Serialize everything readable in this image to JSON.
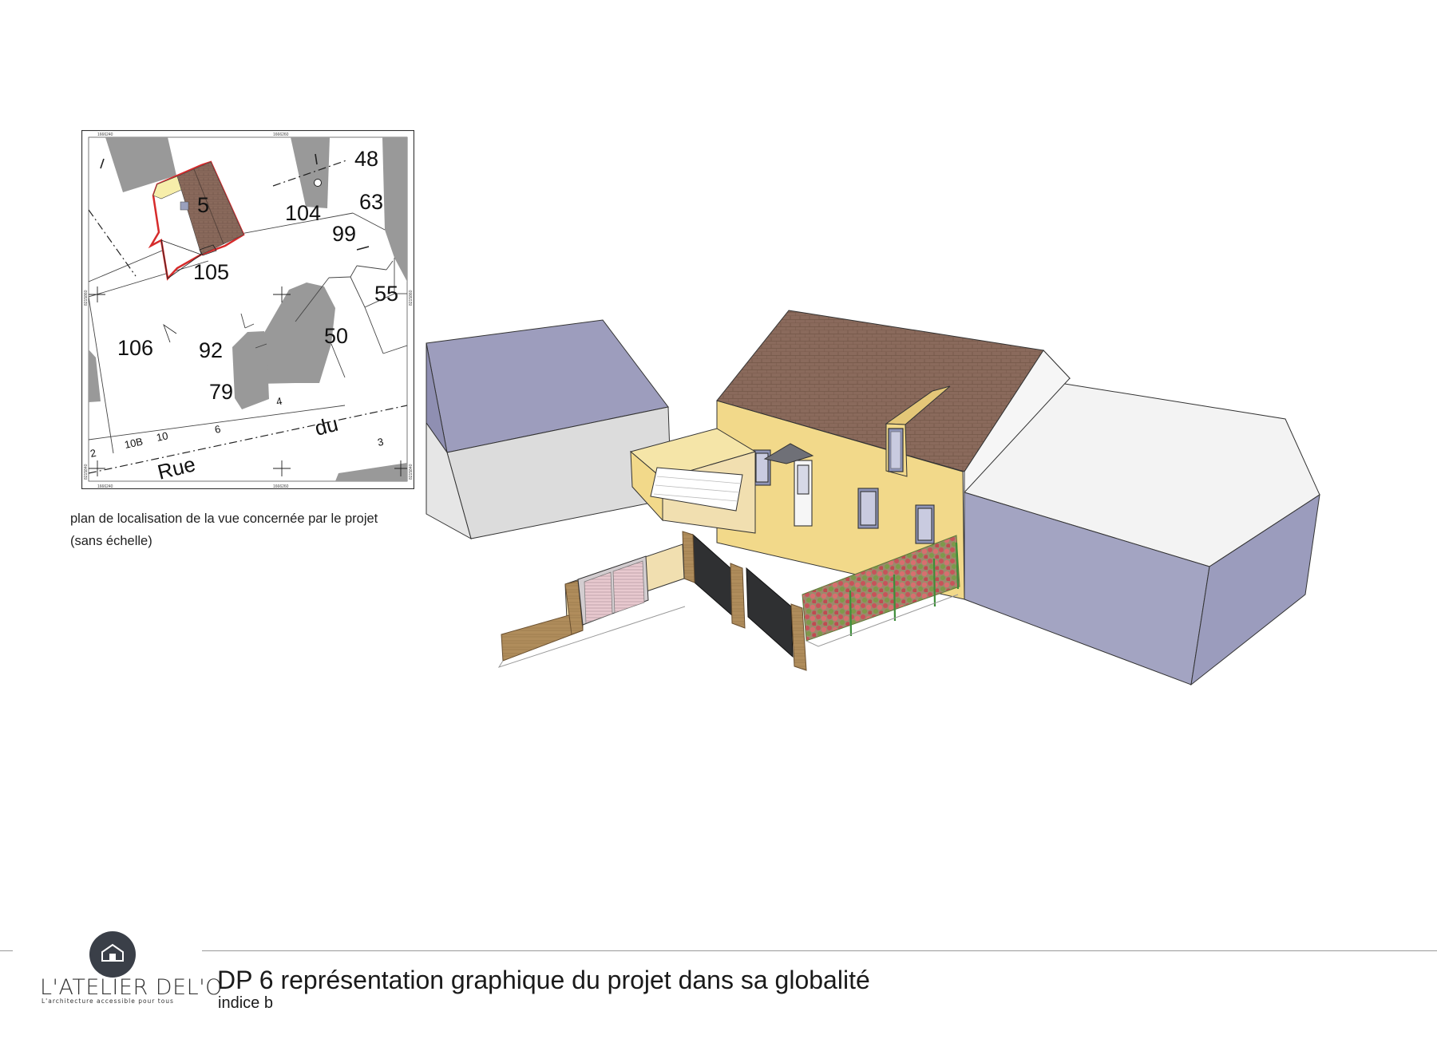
{
  "cadastre": {
    "parcel_numbers": [
      "48",
      "63",
      "104",
      "99",
      "105",
      "55",
      "106",
      "92",
      "50",
      "79",
      "5"
    ],
    "street_numbers": [
      "10B",
      "10",
      "6",
      "4",
      "2",
      "3"
    ],
    "street_words": [
      "Rue",
      "du"
    ],
    "grid_labels": [
      "1666240",
      "1666260",
      "8215860",
      "8215840"
    ]
  },
  "caption": {
    "line1": "plan de localisation de la vue concernée par le projet",
    "line2": "(sans échelle)"
  },
  "footer": {
    "title": "DP 6 représentation graphique du projet dans sa globalité",
    "index": "indice b"
  },
  "logo": {
    "name": "L'ATELIER DEL'O",
    "tagline": "L'architecture accessible pour tous"
  },
  "colors": {
    "roof_tile": "#8a6a5c",
    "facade_yellow": "#f2d98a",
    "neighbor_blue": "#a3a4c2",
    "wall_white": "#f3f3f3",
    "hedge_red": "#c7535a",
    "gate_dark": "#2f3032",
    "timber": "#b08d5c",
    "cad_gray": "#999999",
    "cad_outline": "#d62b2b"
  }
}
